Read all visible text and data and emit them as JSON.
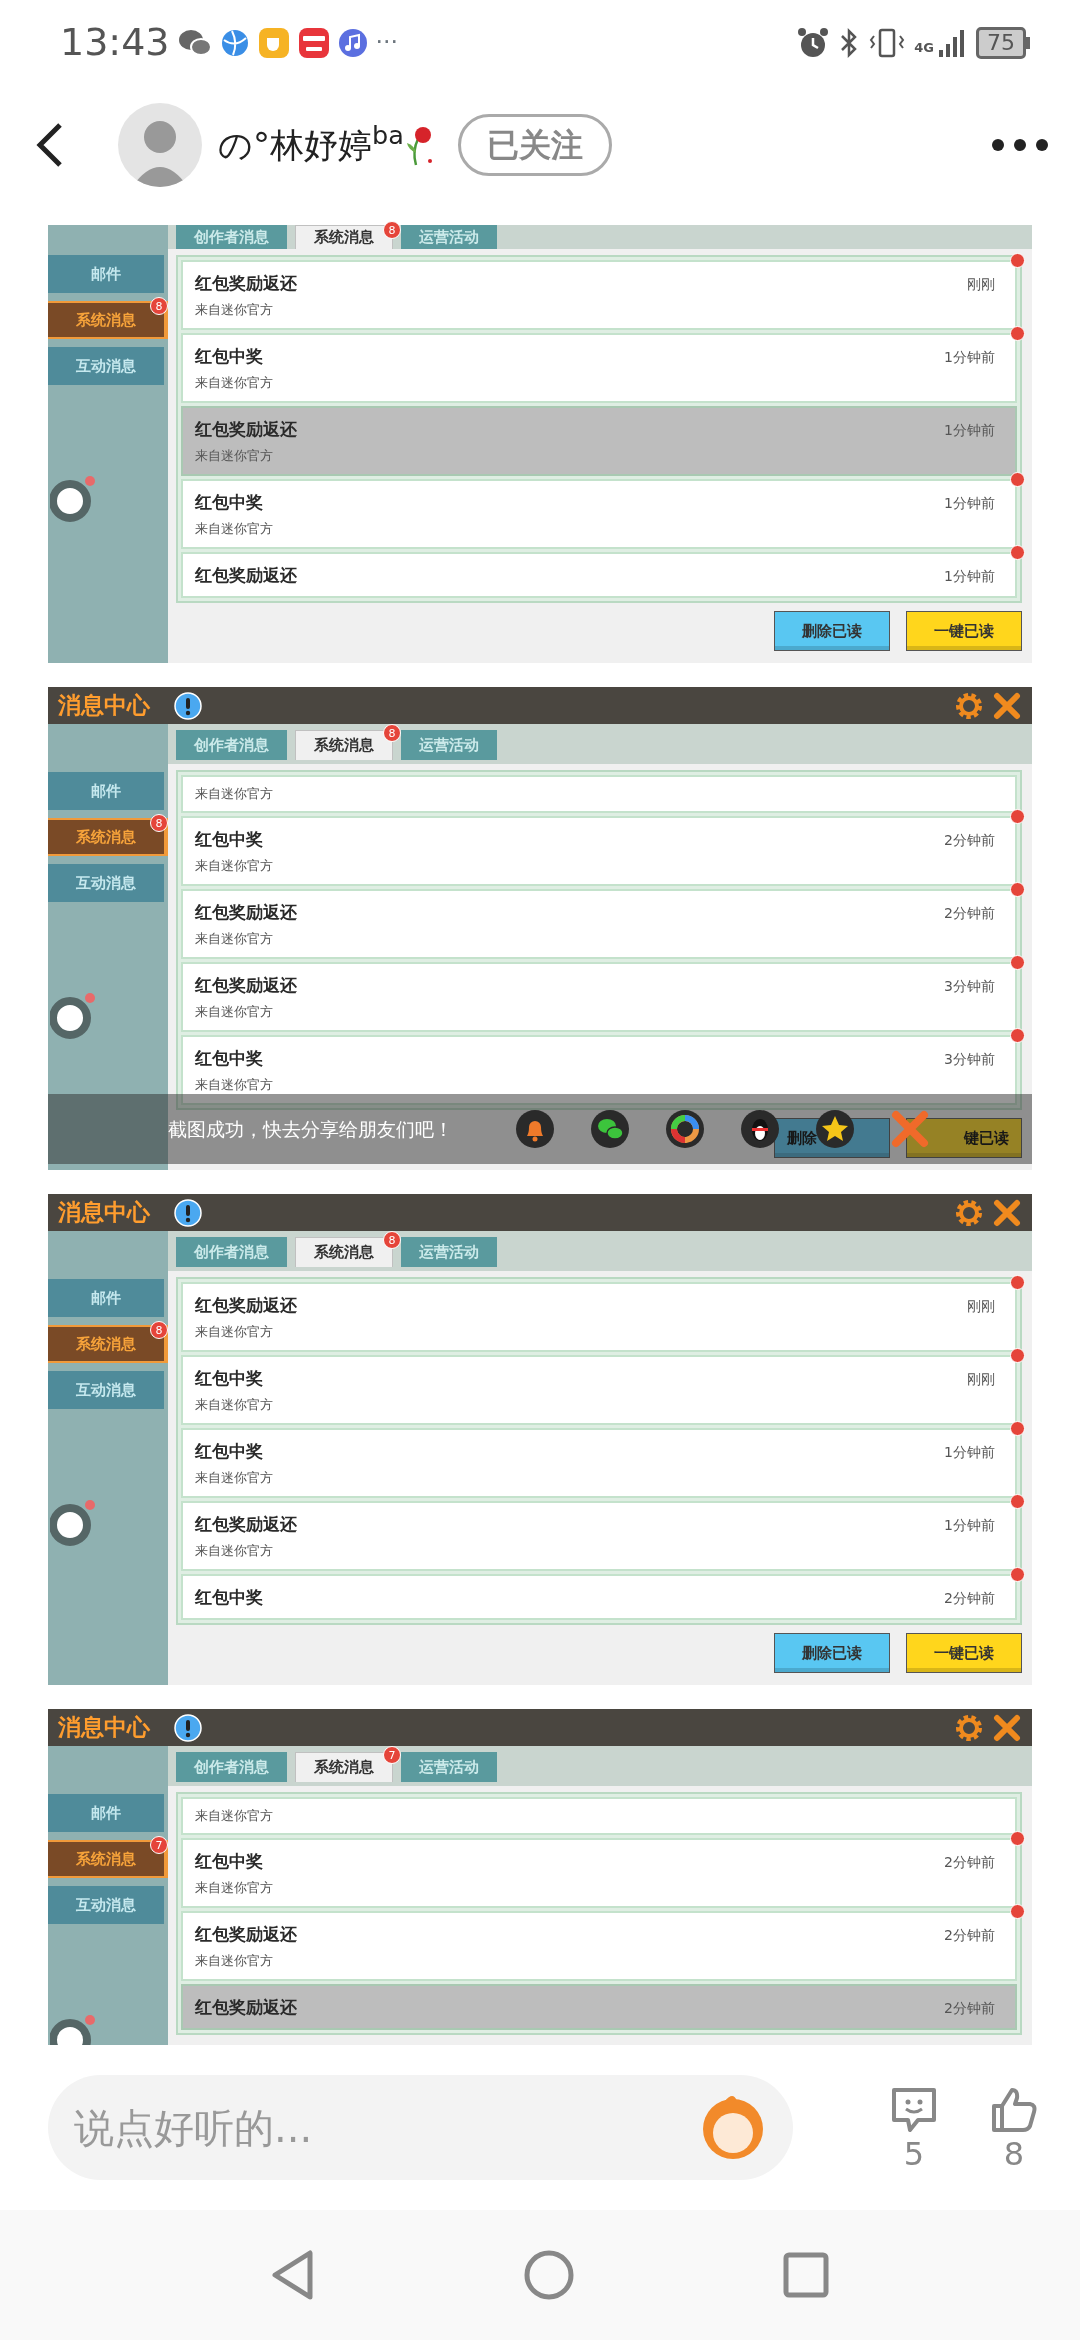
{
  "status_bar": {
    "time": "13:43",
    "more": "···",
    "network": "4G",
    "battery": "75"
  },
  "header": {
    "name": "の°林妤婷$^{ba}$",
    "follow": "已关注"
  },
  "screenshots": [
    {
      "tabs": [
        {
          "label": "创作者消息",
          "selected": false
        },
        {
          "label": "系统消息",
          "selected": true,
          "badge": "8"
        },
        {
          "label": "运营活动",
          "selected": false
        }
      ],
      "sidebar": [
        {
          "label": "邮件",
          "selected": false
        },
        {
          "label": "系统消息",
          "selected": true,
          "badge": "8"
        },
        {
          "label": "互动消息",
          "selected": false
        }
      ],
      "messages": [
        {
          "title": "红包奖励返还",
          "time": "刚刚",
          "source": "来自迷你官方",
          "unread": true,
          "selected": false
        },
        {
          "title": "红包中奖",
          "time": "1分钟前",
          "source": "来自迷你官方",
          "unread": true,
          "selected": false
        },
        {
          "title": "红包奖励返还",
          "time": "1分钟前",
          "source": "来自迷你官方",
          "unread": false,
          "selected": true
        },
        {
          "title": "红包中奖",
          "time": "1分钟前",
          "source": "来自迷你官方",
          "unread": true,
          "selected": false
        },
        {
          "title": "红包奖励返还",
          "time": "1分钟前",
          "unread": true,
          "selected": false
        }
      ],
      "buttons": [
        {
          "label": "删除已读",
          "kind": "delete"
        },
        {
          "label": "一键已读",
          "kind": "read"
        }
      ]
    },
    {
      "title": "消息中心",
      "tabs": [
        {
          "label": "创作者消息",
          "selected": false
        },
        {
          "label": "系统消息",
          "selected": true,
          "badge": "8"
        },
        {
          "label": "运营活动",
          "selected": false
        }
      ],
      "sidebar": [
        {
          "label": "邮件",
          "selected": false
        },
        {
          "label": "系统消息",
          "selected": true,
          "badge": "8"
        },
        {
          "label": "互动消息",
          "selected": false
        }
      ],
      "messages": [
        {
          "source": "来自迷你官方",
          "unread": false,
          "selected": false
        },
        {
          "title": "红包中奖",
          "time": "2分钟前",
          "source": "来自迷你官方",
          "unread": true,
          "selected": false
        },
        {
          "title": "红包奖励返还",
          "time": "2分钟前",
          "source": "来自迷你官方",
          "unread": true,
          "selected": false
        },
        {
          "title": "红包奖励返还",
          "time": "3分钟前",
          "source": "来自迷你官方",
          "unread": true,
          "selected": false
        },
        {
          "title": "红包中奖",
          "time": "3分钟前",
          "source": "来自迷你官方",
          "unread": true,
          "selected": false
        }
      ],
      "buttons": [
        {
          "label": "删除",
          "kind": "delete"
        },
        {
          "label": "键已读",
          "kind": "read"
        }
      ],
      "share_bar": {
        "text": "截图成功，快去分享给朋友们吧！"
      }
    },
    {
      "title": "消息中心",
      "tabs": [
        {
          "label": "创作者消息",
          "selected": false
        },
        {
          "label": "系统消息",
          "selected": true,
          "badge": "8"
        },
        {
          "label": "运营活动",
          "selected": false
        }
      ],
      "sidebar": [
        {
          "label": "邮件",
          "selected": false
        },
        {
          "label": "系统消息",
          "selected": true,
          "badge": "8"
        },
        {
          "label": "互动消息",
          "selected": false
        }
      ],
      "messages": [
        {
          "title": "红包奖励返还",
          "time": "刚刚",
          "source": "来自迷你官方",
          "unread": true,
          "selected": false
        },
        {
          "title": "红包中奖",
          "time": "刚刚",
          "source": "来自迷你官方",
          "unread": true,
          "selected": false
        },
        {
          "title": "红包中奖",
          "time": "1分钟前",
          "source": "来自迷你官方",
          "unread": true,
          "selected": false
        },
        {
          "title": "红包奖励返还",
          "time": "1分钟前",
          "source": "来自迷你官方",
          "unread": true,
          "selected": false
        },
        {
          "title": "红包中奖",
          "time": "2分钟前",
          "unread": true,
          "selected": false
        }
      ],
      "buttons": [
        {
          "label": "删除已读",
          "kind": "delete"
        },
        {
          "label": "一键已读",
          "kind": "read"
        }
      ]
    },
    {
      "title": "消息中心",
      "tabs": [
        {
          "label": "创作者消息",
          "selected": false
        },
        {
          "label": "系统消息",
          "selected": true,
          "badge": "7"
        },
        {
          "label": "运营活动",
          "selected": false
        }
      ],
      "sidebar": [
        {
          "label": "邮件",
          "selected": false
        },
        {
          "label": "系统消息",
          "selected": true,
          "badge": "7"
        },
        {
          "label": "互动消息",
          "selected": false
        }
      ],
      "messages": [
        {
          "source": "来自迷你官方",
          "unread": false,
          "selected": false
        },
        {
          "title": "红包中奖",
          "time": "2分钟前",
          "source": "来自迷你官方",
          "unread": true,
          "selected": false
        },
        {
          "title": "红包奖励返还",
          "time": "2分钟前",
          "source": "来自迷你官方",
          "unread": true,
          "selected": false
        },
        {
          "title": "红包奖励返还",
          "time": "2分钟前",
          "unread": false,
          "selected": true
        }
      ]
    }
  ],
  "comment_bar": {
    "placeholder": "说点好听的...",
    "comments": "5",
    "likes": "8"
  }
}
